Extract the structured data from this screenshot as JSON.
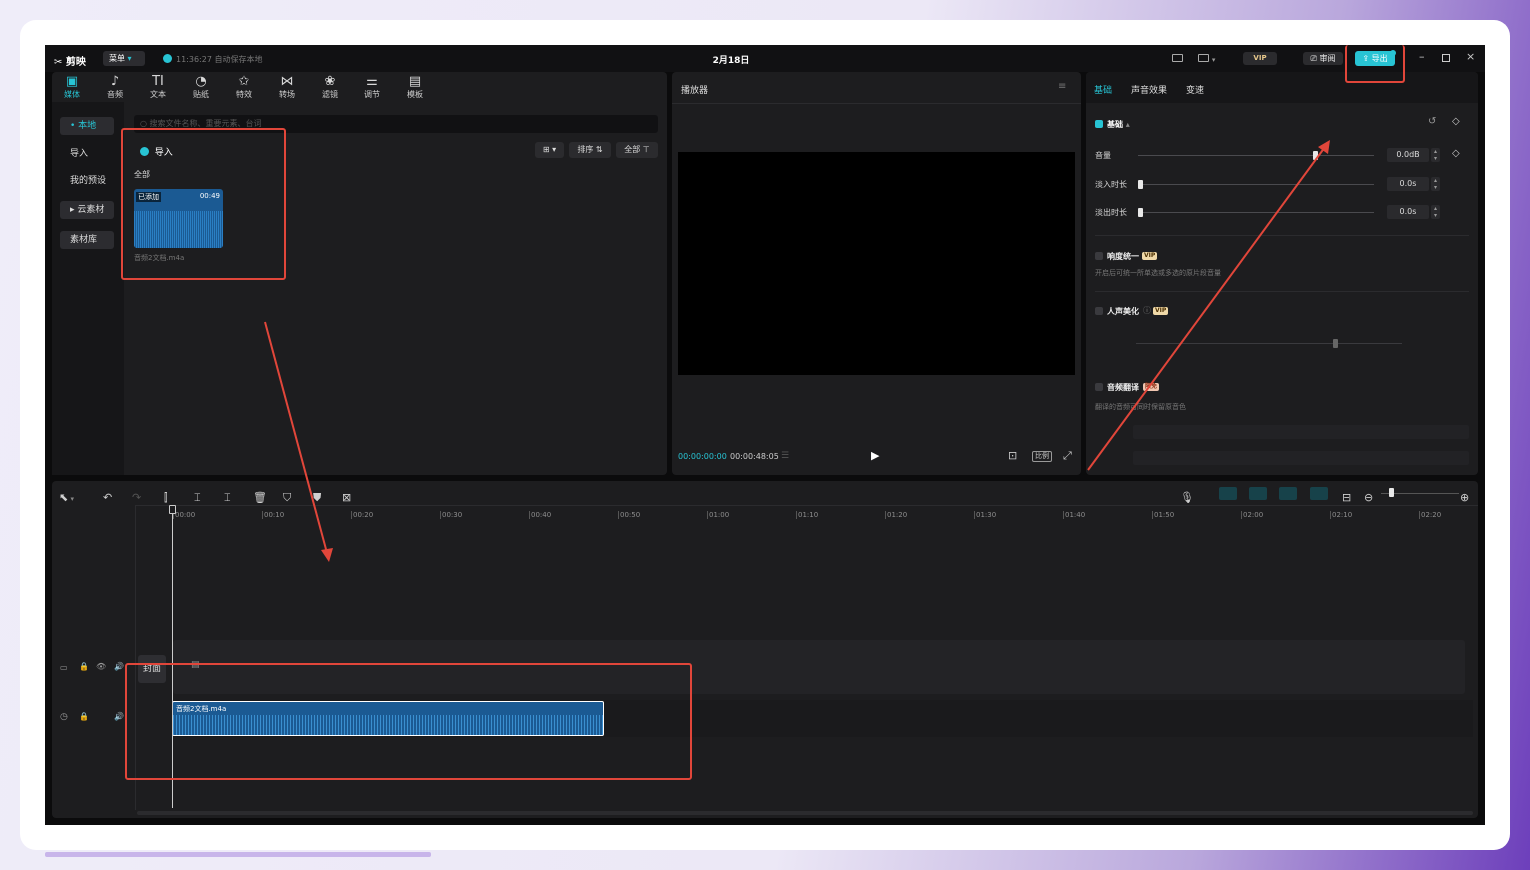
{
  "app": {
    "logo": "剪映",
    "menu_label": "菜单",
    "save_status": "11:36:27 自动保存本地",
    "project_title": "2月18日",
    "vip_label": "VIP",
    "review_label": "审阅",
    "export_label": "导出"
  },
  "toolbar": {
    "tools": [
      {
        "label": "媒体",
        "icon": "media-icon",
        "glyph": "▣"
      },
      {
        "label": "音频",
        "icon": "audio-icon",
        "glyph": "♪"
      },
      {
        "label": "文本",
        "icon": "text-icon",
        "glyph": "TI"
      },
      {
        "label": "贴纸",
        "icon": "sticker-icon",
        "glyph": "◔"
      },
      {
        "label": "特效",
        "icon": "effects-icon",
        "glyph": "✩"
      },
      {
        "label": "转场",
        "icon": "transition-icon",
        "glyph": "⋈"
      },
      {
        "label": "滤镜",
        "icon": "filter-icon",
        "glyph": "❀"
      },
      {
        "label": "调节",
        "icon": "adjust-icon",
        "glyph": "⚌"
      },
      {
        "label": "模板",
        "icon": "template-icon",
        "glyph": "▤"
      }
    ]
  },
  "sidebar": {
    "items": [
      {
        "label": "• 本地"
      },
      {
        "label": "导入"
      },
      {
        "label": "我的预设"
      },
      {
        "label": "▸ 云素材"
      },
      {
        "label": "素材库"
      }
    ]
  },
  "media": {
    "search_placeholder": "搜索文件名称、重要元素、台词",
    "import_label": "导入",
    "sort_label": "排序",
    "all_label": "全部",
    "section_label": "全部",
    "clip": {
      "badge": "已添加",
      "duration": "00:49",
      "filename": "音频2文档.m4a"
    }
  },
  "player": {
    "title": "播放器",
    "current_time": "00:00:00:00",
    "total_time": "00:00:48:05",
    "ratio_label": "比例"
  },
  "inspector": {
    "tabs": [
      "基础",
      "声音效果",
      "变速"
    ],
    "section_basic": "基础",
    "volume_label": "音量",
    "volume_value": "0.0dB",
    "volume_level": 0.75,
    "fade_in_label": "淡入时长",
    "fade_in_value": "0.0s",
    "fade_out_label": "淡出时长",
    "fade_out_value": "0.0s",
    "loudness_label": "响度统一",
    "loudness_desc": "开启后可统一所单选或多选的原片段音量",
    "voice_enhance_label": "人声美化",
    "translate_label": "音频翻译",
    "translate_badge": "限免",
    "translate_desc": "翻译的音频可同时保留原音色",
    "vip_tag": "VIP"
  },
  "timeline": {
    "ticks": [
      "00:00",
      "00:10",
      "00:20",
      "00:30",
      "00:40",
      "00:50",
      "01:00",
      "01:10",
      "01:20",
      "01:30",
      "01:40",
      "01:50",
      "02:00",
      "02:10",
      "02:20"
    ],
    "cover_label": "封面",
    "audio_clip_label": "音频2文档.m4a"
  },
  "colors": {
    "accent": "#28c4d4",
    "annotation": "#e1463a",
    "clip_blue": "#1b5a93"
  }
}
